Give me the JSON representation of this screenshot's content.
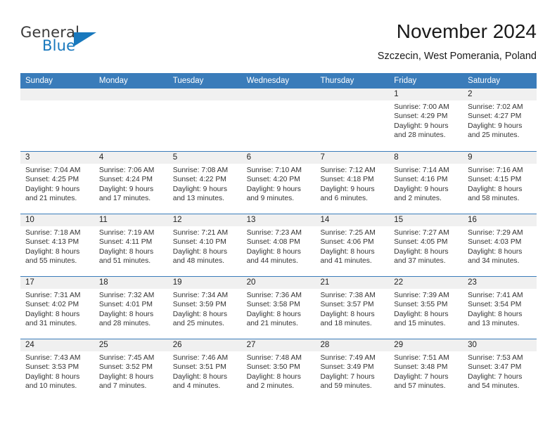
{
  "brand": {
    "line1": "General",
    "line2": "Blue",
    "triangle_color": "#1878bd",
    "icon": "triangle-logo-icon"
  },
  "header": {
    "title": "November 2024",
    "subtitle": "Szczecin, West Pomerania, Poland"
  },
  "theme": {
    "header_blue": "#3a7cba",
    "date_band_gray": "#f0f0f0",
    "text": "#222222"
  },
  "calendar": {
    "day_names": [
      "Sunday",
      "Monday",
      "Tuesday",
      "Wednesday",
      "Thursday",
      "Friday",
      "Saturday"
    ],
    "weeks": [
      [
        {
          "date": "",
          "empty": true
        },
        {
          "date": "",
          "empty": true
        },
        {
          "date": "",
          "empty": true
        },
        {
          "date": "",
          "empty": true
        },
        {
          "date": "",
          "empty": true
        },
        {
          "date": "1",
          "sunrise": "Sunrise: 7:00 AM",
          "sunset": "Sunset: 4:29 PM",
          "daylight1": "Daylight: 9 hours",
          "daylight2": "and 28 minutes."
        },
        {
          "date": "2",
          "sunrise": "Sunrise: 7:02 AM",
          "sunset": "Sunset: 4:27 PM",
          "daylight1": "Daylight: 9 hours",
          "daylight2": "and 25 minutes."
        }
      ],
      [
        {
          "date": "3",
          "sunrise": "Sunrise: 7:04 AM",
          "sunset": "Sunset: 4:25 PM",
          "daylight1": "Daylight: 9 hours",
          "daylight2": "and 21 minutes."
        },
        {
          "date": "4",
          "sunrise": "Sunrise: 7:06 AM",
          "sunset": "Sunset: 4:24 PM",
          "daylight1": "Daylight: 9 hours",
          "daylight2": "and 17 minutes."
        },
        {
          "date": "5",
          "sunrise": "Sunrise: 7:08 AM",
          "sunset": "Sunset: 4:22 PM",
          "daylight1": "Daylight: 9 hours",
          "daylight2": "and 13 minutes."
        },
        {
          "date": "6",
          "sunrise": "Sunrise: 7:10 AM",
          "sunset": "Sunset: 4:20 PM",
          "daylight1": "Daylight: 9 hours",
          "daylight2": "and 9 minutes."
        },
        {
          "date": "7",
          "sunrise": "Sunrise: 7:12 AM",
          "sunset": "Sunset: 4:18 PM",
          "daylight1": "Daylight: 9 hours",
          "daylight2": "and 6 minutes."
        },
        {
          "date": "8",
          "sunrise": "Sunrise: 7:14 AM",
          "sunset": "Sunset: 4:16 PM",
          "daylight1": "Daylight: 9 hours",
          "daylight2": "and 2 minutes."
        },
        {
          "date": "9",
          "sunrise": "Sunrise: 7:16 AM",
          "sunset": "Sunset: 4:15 PM",
          "daylight1": "Daylight: 8 hours",
          "daylight2": "and 58 minutes."
        }
      ],
      [
        {
          "date": "10",
          "sunrise": "Sunrise: 7:18 AM",
          "sunset": "Sunset: 4:13 PM",
          "daylight1": "Daylight: 8 hours",
          "daylight2": "and 55 minutes."
        },
        {
          "date": "11",
          "sunrise": "Sunrise: 7:19 AM",
          "sunset": "Sunset: 4:11 PM",
          "daylight1": "Daylight: 8 hours",
          "daylight2": "and 51 minutes."
        },
        {
          "date": "12",
          "sunrise": "Sunrise: 7:21 AM",
          "sunset": "Sunset: 4:10 PM",
          "daylight1": "Daylight: 8 hours",
          "daylight2": "and 48 minutes."
        },
        {
          "date": "13",
          "sunrise": "Sunrise: 7:23 AM",
          "sunset": "Sunset: 4:08 PM",
          "daylight1": "Daylight: 8 hours",
          "daylight2": "and 44 minutes."
        },
        {
          "date": "14",
          "sunrise": "Sunrise: 7:25 AM",
          "sunset": "Sunset: 4:06 PM",
          "daylight1": "Daylight: 8 hours",
          "daylight2": "and 41 minutes."
        },
        {
          "date": "15",
          "sunrise": "Sunrise: 7:27 AM",
          "sunset": "Sunset: 4:05 PM",
          "daylight1": "Daylight: 8 hours",
          "daylight2": "and 37 minutes."
        },
        {
          "date": "16",
          "sunrise": "Sunrise: 7:29 AM",
          "sunset": "Sunset: 4:03 PM",
          "daylight1": "Daylight: 8 hours",
          "daylight2": "and 34 minutes."
        }
      ],
      [
        {
          "date": "17",
          "sunrise": "Sunrise: 7:31 AM",
          "sunset": "Sunset: 4:02 PM",
          "daylight1": "Daylight: 8 hours",
          "daylight2": "and 31 minutes."
        },
        {
          "date": "18",
          "sunrise": "Sunrise: 7:32 AM",
          "sunset": "Sunset: 4:01 PM",
          "daylight1": "Daylight: 8 hours",
          "daylight2": "and 28 minutes."
        },
        {
          "date": "19",
          "sunrise": "Sunrise: 7:34 AM",
          "sunset": "Sunset: 3:59 PM",
          "daylight1": "Daylight: 8 hours",
          "daylight2": "and 25 minutes."
        },
        {
          "date": "20",
          "sunrise": "Sunrise: 7:36 AM",
          "sunset": "Sunset: 3:58 PM",
          "daylight1": "Daylight: 8 hours",
          "daylight2": "and 21 minutes."
        },
        {
          "date": "21",
          "sunrise": "Sunrise: 7:38 AM",
          "sunset": "Sunset: 3:57 PM",
          "daylight1": "Daylight: 8 hours",
          "daylight2": "and 18 minutes."
        },
        {
          "date": "22",
          "sunrise": "Sunrise: 7:39 AM",
          "sunset": "Sunset: 3:55 PM",
          "daylight1": "Daylight: 8 hours",
          "daylight2": "and 15 minutes."
        },
        {
          "date": "23",
          "sunrise": "Sunrise: 7:41 AM",
          "sunset": "Sunset: 3:54 PM",
          "daylight1": "Daylight: 8 hours",
          "daylight2": "and 13 minutes."
        }
      ],
      [
        {
          "date": "24",
          "sunrise": "Sunrise: 7:43 AM",
          "sunset": "Sunset: 3:53 PM",
          "daylight1": "Daylight: 8 hours",
          "daylight2": "and 10 minutes."
        },
        {
          "date": "25",
          "sunrise": "Sunrise: 7:45 AM",
          "sunset": "Sunset: 3:52 PM",
          "daylight1": "Daylight: 8 hours",
          "daylight2": "and 7 minutes."
        },
        {
          "date": "26",
          "sunrise": "Sunrise: 7:46 AM",
          "sunset": "Sunset: 3:51 PM",
          "daylight1": "Daylight: 8 hours",
          "daylight2": "and 4 minutes."
        },
        {
          "date": "27",
          "sunrise": "Sunrise: 7:48 AM",
          "sunset": "Sunset: 3:50 PM",
          "daylight1": "Daylight: 8 hours",
          "daylight2": "and 2 minutes."
        },
        {
          "date": "28",
          "sunrise": "Sunrise: 7:49 AM",
          "sunset": "Sunset: 3:49 PM",
          "daylight1": "Daylight: 7 hours",
          "daylight2": "and 59 minutes."
        },
        {
          "date": "29",
          "sunrise": "Sunrise: 7:51 AM",
          "sunset": "Sunset: 3:48 PM",
          "daylight1": "Daylight: 7 hours",
          "daylight2": "and 57 minutes."
        },
        {
          "date": "30",
          "sunrise": "Sunrise: 7:53 AM",
          "sunset": "Sunset: 3:47 PM",
          "daylight1": "Daylight: 7 hours",
          "daylight2": "and 54 minutes."
        }
      ]
    ]
  }
}
